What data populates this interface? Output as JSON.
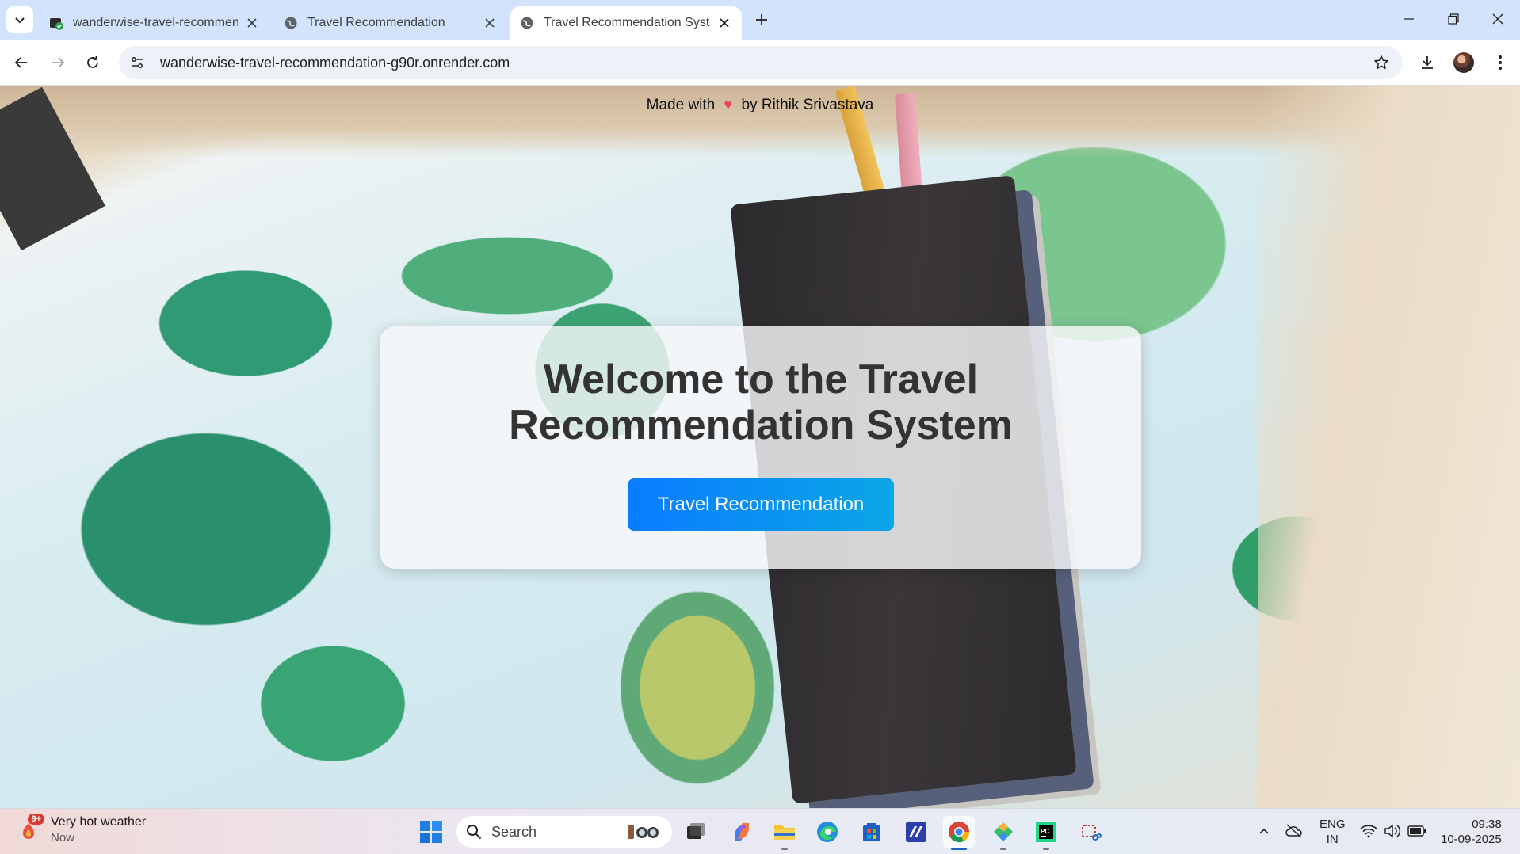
{
  "browser": {
    "tabs": [
      {
        "title": "wanderwise-travel-recommend",
        "active": false
      },
      {
        "title": "Travel Recommendation",
        "active": false
      },
      {
        "title": "Travel Recommendation System",
        "active": true
      }
    ],
    "url": "wanderwise-travel-recommendation-g90r.onrender.com"
  },
  "page": {
    "credit_prefix": "Made with",
    "credit_heart": "♥",
    "credit_suffix": "by Rithik Srivastava",
    "heading": "Welcome to the Travel Recommendation System",
    "cta_label": "Travel Recommendation"
  },
  "taskbar": {
    "weather_title": "Very hot weather",
    "weather_sub": "Now",
    "weather_badge": "9+",
    "search_label": "Search",
    "lang_line1": "ENG",
    "lang_line2": "IN",
    "time": "09:38",
    "date": "10-09-2025"
  },
  "colors": {
    "tabstrip": "#d3e3fd",
    "cta_start": "#0a7cff",
    "cta_end": "#0aa6e6",
    "heart": "#e8415a"
  },
  "icons": [
    "tab-search-icon",
    "favicon-icon",
    "globe-icon",
    "close-icon",
    "plus-icon",
    "minimize-icon",
    "restore-icon",
    "back-icon",
    "forward-icon",
    "reload-icon",
    "site-settings-icon",
    "bookmark-star-icon",
    "download-icon",
    "avatar",
    "menu-icon",
    "windows-start-icon",
    "search-icon",
    "task-view-icon",
    "copilot-icon",
    "file-explorer-icon",
    "edge-icon",
    "store-icon",
    "vscode-icon",
    "chrome-icon",
    "app-icon",
    "pycharm-icon",
    "snipping-icon",
    "chevron-up-icon",
    "onedrive-icon",
    "wifi-icon",
    "volume-icon",
    "battery-icon"
  ]
}
